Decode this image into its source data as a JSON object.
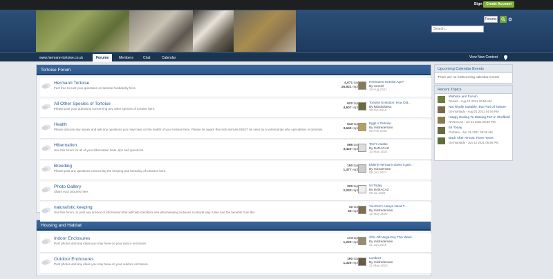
{
  "topbar": {
    "sign_in": "Sign In",
    "create_account": "Create Account"
  },
  "search": {
    "placeholder": "Search...",
    "scope": "Forums"
  },
  "nav": {
    "site": "www.hermann-tortoise.co.uk",
    "tabs": [
      "Forums",
      "Members",
      "Chat",
      "Calendar"
    ],
    "view_new": "View New Content"
  },
  "sections": [
    {
      "title": "Tortoise Forum",
      "forums": [
        {
          "title": "Hermann Tortoise",
          "desc": "Feel free to post your questions on tortoise husbandry here.",
          "topics": "4,071",
          "replies": "26,921",
          "last_title": "Hermanns Tortoise Age?",
          "last_by": "By conniel",
          "last_date": "19 Aug 2021"
        },
        {
          "title": "All Other Species of Tortoise",
          "desc": "Please post your questions concerning any other species of tortoise here.",
          "topics": "622",
          "replies": "4,607",
          "last_title": "Tortoise Evolution: How Did...",
          "last_by": "By kabaltoldesu",
          "last_date": "20 Oct 2016"
        },
        {
          "title": "Health",
          "desc": "Please discuss any issues and ask any questions you may have on the health of your tortoise here. Please be aware that sick animals MUST be seen by a veterinarian who specialises in tortoises.",
          "topics": "513",
          "replies": "3,640",
          "last_title": "Eggs A Tortoise.",
          "last_by": "By mildredemani",
          "last_date": "06 Feb 2020"
        },
        {
          "title": "Hibernation",
          "desc": "Use this forum for all of your hibernation hints, tips and questions.",
          "topics": "566",
          "replies": "3,420",
          "last_title": "Terri's Awake",
          "last_by": "By NANACAZ",
          "last_date": "10 May 2021"
        },
        {
          "title": "Breeding",
          "desc": "Please post any questions concerning the keeping and breeding of tortoises here.",
          "topics": "150",
          "replies": "1,477",
          "last_title": "Elderly Hermann doesn't gain...",
          "last_by": "By mizzaemam",
          "last_date": "09 Jun 2021"
        },
        {
          "title": "Photo Gallery",
          "desc": "Share your pictures here.",
          "topics": "320",
          "replies": "2,033",
          "last_title": "54 Today",
          "last_by": "By NANACAZ",
          "last_date": "09 Jul 2021"
        },
        {
          "title": "naturalistic keeping",
          "desc": "Use this forum, to post any articles or information that will help members see what keeping tortoises a natural way is like and the benefits from this.",
          "topics": "10",
          "replies": "55",
          "last_title": "You Don't Always Need T...",
          "last_by": "By mildredemani",
          "last_date": "12 May 2020"
        }
      ]
    },
    {
      "title": "Housing and Habitat",
      "forums": [
        {
          "title": "Indoor Enclosures",
          "desc": "Post photos and any ideas you may have on your indoor enclosure.",
          "topics": "174",
          "replies": "1,222",
          "last_title": "20% Off Mega-Ray This Week",
          "last_by": "By mildredemani",
          "last_date": "21 Jun 2019"
        },
        {
          "title": "Outdoor Enclosures",
          "desc": "Post photos and any ideas you may have on your outdoor enclosure.",
          "topics": "190",
          "replies": "1,329",
          "last_title": "Lumbret",
          "last_by": "By mildredemani",
          "last_date": "21 May 2020"
        }
      ]
    }
  ],
  "labels": {
    "topics": "topics",
    "replies": "replies"
  },
  "sidebar": {
    "events_title": "Upcoming Calendar Events",
    "events_empty": "There are no forthcoming calendar events",
    "recent_title": "Recent Topics",
    "topics": [
      {
        "title": "Website and Forum",
        "meta": "Daniah - Aug 12 2021 10:54 AM"
      },
      {
        "title": "Not Really Suitable, But Part Of Nature",
        "meta": "Germanlady - Aug 01 2021 04:06 PM"
      },
      {
        "title": "Happy Ending To Missing Tort In Sheffield",
        "meta": "NANACAZ - Jul 24 2021 08:36 PM"
      },
      {
        "title": "54 Today",
        "meta": "Graham - Jun 26 2021 09:36 AM"
      },
      {
        "title": "Back After Almost Three Years",
        "meta": "Germanlady - Jun 13 2021 06:46 PM"
      }
    ]
  },
  "colors": {
    "brand": "#2d5789",
    "accent": "#7fb034",
    "link": "#2d5c91"
  }
}
